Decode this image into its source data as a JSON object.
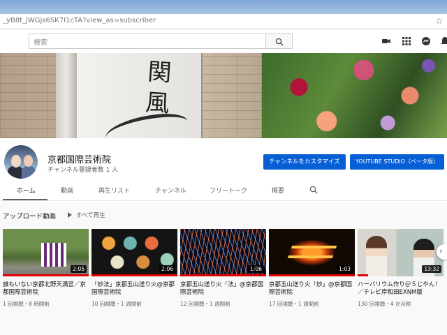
{
  "browser": {
    "url": "_yB8t_jWGjs6SK7I1cTA?view_as=subscriber",
    "bookmark_icon": "star-icon"
  },
  "masthead": {
    "search_placeholder": "検索",
    "icons": [
      "search-icon",
      "video-camera-icon",
      "apps-grid-icon",
      "messages-icon",
      "notifications-bell-icon"
    ]
  },
  "channel": {
    "name": "京都国際芸術院",
    "subscribers": "チャンネル登録者数 1 人",
    "customize_label": "チャンネルをカスタマイズ",
    "studio_label": "YOUTUBE STUDIO（ベータ版）"
  },
  "tabs": [
    {
      "label": "ホーム",
      "active": true
    },
    {
      "label": "動画"
    },
    {
      "label": "再生リスト"
    },
    {
      "label": "チャンネル"
    },
    {
      "label": "フリートーク"
    },
    {
      "label": "概要"
    }
  ],
  "uploads": {
    "title": "アップロード動画",
    "play_all": "すべて再生",
    "videos": [
      {
        "title": "誰もいない京都北野天満宮／京都国際芸術院",
        "duration": "2:05",
        "meta": "1 回視聴・8 時間前",
        "watched": 1.0
      },
      {
        "title": "「妙法」京都五山送り火@京都国際芸術院",
        "duration": "2:06",
        "meta": "10 回視聴・1 週間前",
        "watched": 1.0
      },
      {
        "title": "京都五山送り火「法」@京都国際芸術院",
        "duration": "1:06",
        "meta": "12 回視聴・1 週間前",
        "watched": 1.0
      },
      {
        "title": "京都五山送り火「妙」@京都国際芸術院",
        "duration": "1:03",
        "meta": "17 回視聴・1 週間前",
        "watched": 1.0
      },
      {
        "title": "ハーバリウム作り＠５じやん！／テレビ岸和田EXNM版",
        "duration": "13:32",
        "meta": "130 回視聴・4 か月前",
        "watched": 0.12
      }
    ]
  },
  "colors": {
    "accent_blue": "#065fd4",
    "progress_red": "#e00000"
  }
}
